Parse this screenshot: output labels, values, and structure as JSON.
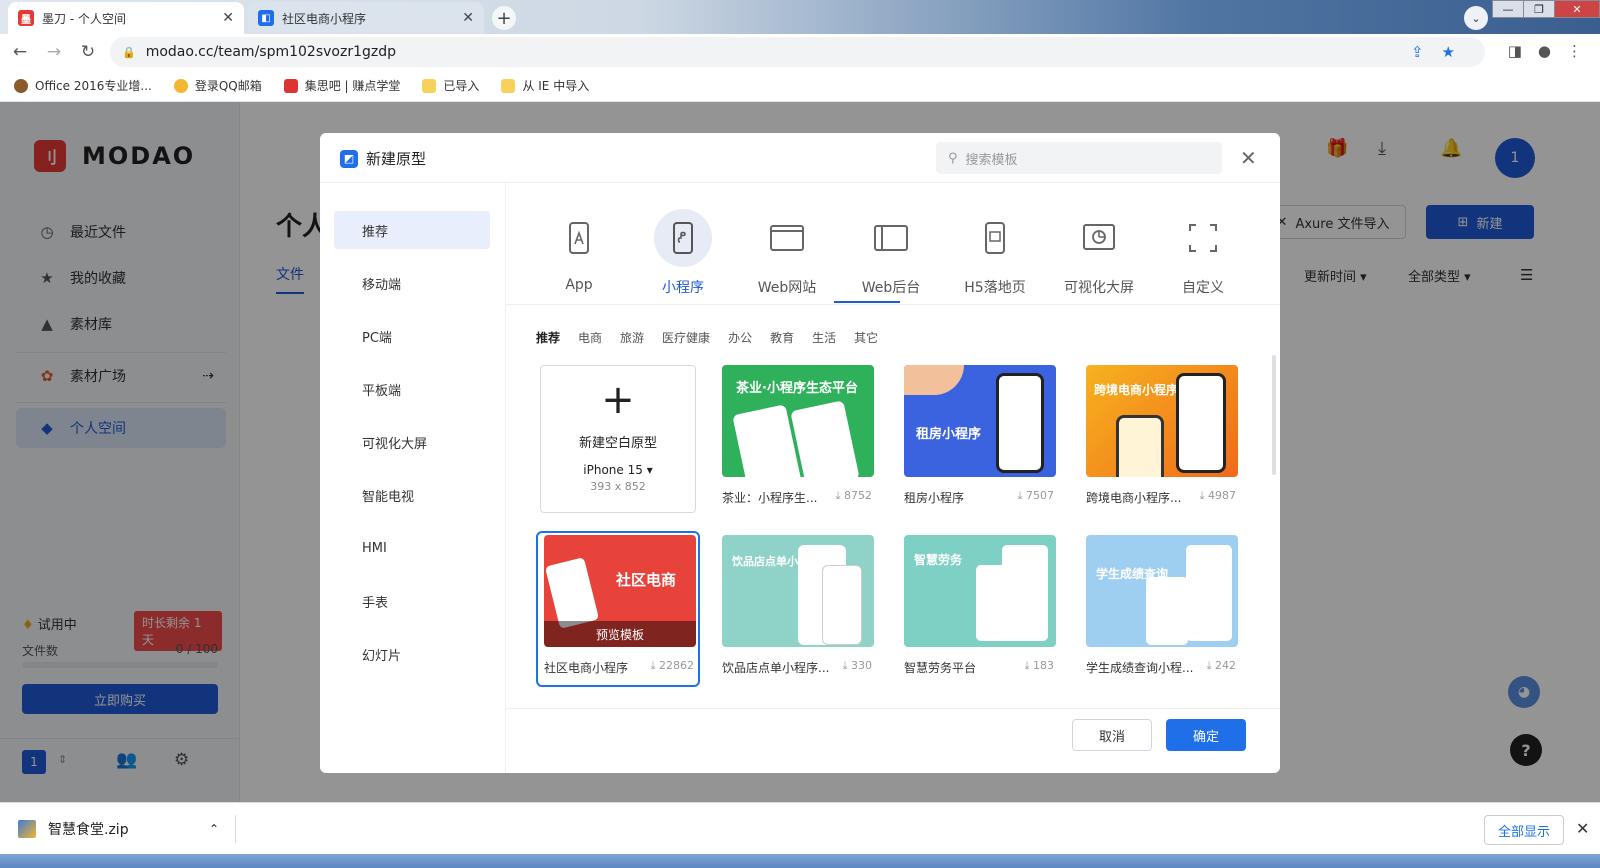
{
  "browser": {
    "tabs": [
      {
        "title": "墨刀 - 个人空间",
        "active": true
      },
      {
        "title": "社区电商小程序",
        "active": false
      }
    ],
    "url": "modao.cc/team/spm102svozr1gzdp",
    "bookmarks": [
      "Office 2016专业增...",
      "登录QQ邮箱",
      "集思吧 | 赚点学堂",
      "已导入",
      "从 IE 中导入"
    ]
  },
  "app": {
    "logo_text": "MODAO",
    "nav": [
      {
        "label": "最近文件",
        "icon": "clock-icon"
      },
      {
        "label": "我的收藏",
        "icon": "star-icon"
      },
      {
        "label": "素材库",
        "icon": "library-icon"
      },
      {
        "label": "素材广场",
        "icon": "shapes-icon"
      },
      {
        "label": "个人空间",
        "icon": "cube-icon"
      }
    ],
    "trial_label": "试用中",
    "trial_badge": "时长剩余 1 天",
    "files_label": "文件数",
    "files_count": "0 / 100",
    "files_used_fraction": 0,
    "buy_label": "立即购买",
    "team_number": "1",
    "page_title": "个人",
    "main_tab": "文件",
    "axure_import": "Axure 文件导入",
    "new_label": "新建",
    "sort_time": "更新时间",
    "sort_type": "全部类型",
    "avatar_label": "1"
  },
  "modal": {
    "title": "新建原型",
    "search_placeholder": "搜索模板",
    "categories": [
      "推荐",
      "移动端",
      "PC端",
      "平板端",
      "可视化大屏",
      "智能电视",
      "HMI",
      "手表",
      "幻灯片"
    ],
    "selected_category": "推荐",
    "devices": [
      {
        "label": "App",
        "icon": "app-phone-icon"
      },
      {
        "label": "小程序",
        "icon": "mini-program-icon"
      },
      {
        "label": "Web网站",
        "icon": "web-window-icon"
      },
      {
        "label": "Web后台",
        "icon": "web-admin-icon"
      },
      {
        "label": "H5落地页",
        "icon": "h5-page-icon"
      },
      {
        "label": "可视化大屏",
        "icon": "dashboard-icon"
      },
      {
        "label": "自定义",
        "icon": "custom-frame-icon"
      }
    ],
    "selected_device": "小程序",
    "subcategories": [
      "推荐",
      "电商",
      "旅游",
      "医疗健康",
      "办公",
      "教育",
      "生活",
      "其它"
    ],
    "blank": {
      "title": "新建空白原型",
      "device": "iPhone 15",
      "size": "393 x 852"
    },
    "templates": [
      {
        "name": "茶业：小程序生...",
        "downloads": "8752",
        "thumb_text": "茶业·小程序生态平台",
        "color": "#2fb05a"
      },
      {
        "name": "租房小程序",
        "downloads": "7507",
        "thumb_text": "租房小程序",
        "color": "#3b63e0"
      },
      {
        "name": "跨境电商小程序...",
        "downloads": "4987",
        "thumb_text": "跨境电商小程序",
        "color": "#f5a623"
      },
      {
        "name": "社区电商小程序",
        "downloads": "22862",
        "thumb_text": "社区电商",
        "color": "#e8433a",
        "preview": "预览模板"
      },
      {
        "name": "饮品店点单小程序...",
        "downloads": "330",
        "thumb_text": "饮品店点单小程序",
        "color": "#8fd3c8"
      },
      {
        "name": "智慧劳务平台",
        "downloads": "183",
        "thumb_text": "智慧劳务",
        "color": "#7fd0c4"
      },
      {
        "name": "学生成绩查询小程...",
        "downloads": "242",
        "thumb_text": "学生成绩查询",
        "color": "#9fcff0"
      }
    ],
    "cancel_label": "取消",
    "ok_label": "确定"
  },
  "download_bar": {
    "file": "智慧食堂.zip",
    "show_all": "全部显示"
  }
}
